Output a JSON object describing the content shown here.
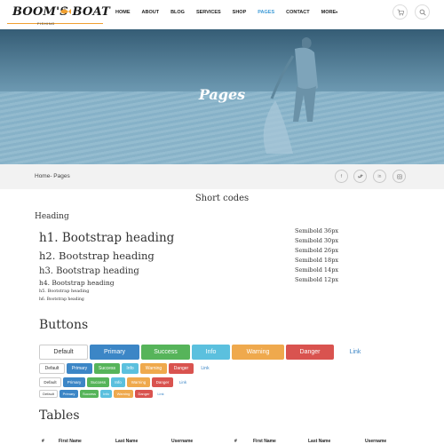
{
  "brand": {
    "name": "BOOM'S   BOAT",
    "sub": "FISHING",
    "accent": "#f0a030"
  },
  "nav": {
    "items": [
      "HOME",
      "ABOUT",
      "BLOG",
      "SERVICES",
      "SHOP",
      "PAGES",
      "CONTACT",
      "MORE"
    ],
    "active": "PAGES"
  },
  "hero": {
    "title": "Pages"
  },
  "breadcrumb": {
    "text": "Home- Pages"
  },
  "social_icons": [
    "facebook-icon",
    "twitter-icon",
    "linkedin-icon",
    "instagram-icon"
  ],
  "main": {
    "section_title": "Short codes",
    "heading_label": "Heading",
    "headings": [
      "h1. Bootstrap heading",
      "h2. Bootstrap heading",
      "h3. Bootstrap heading",
      "h4. Bootstrap heading",
      "h5. Bootstrap heading",
      "h6. Bootstrap heading"
    ],
    "semibold": [
      "Semibold 36px",
      "Semibold 30px",
      "Semibold 26px",
      "Semibold 18px",
      "Semibold 14px",
      "Semibold 12px"
    ],
    "buttons_title": "Buttons",
    "button_labels": [
      "Default",
      "Primary",
      "Success",
      "Info",
      "Warning",
      "Danger",
      "Link"
    ],
    "tables_title": "Tables",
    "table_headers": [
      "#",
      "First Name",
      "Last Name",
      "Username"
    ]
  },
  "colors": {
    "primary": "#3c86c6",
    "success": "#56b45a",
    "info": "#5bc0de",
    "warning": "#efa94d",
    "danger": "#d9534f",
    "nav_active": "#3c9ad6"
  }
}
